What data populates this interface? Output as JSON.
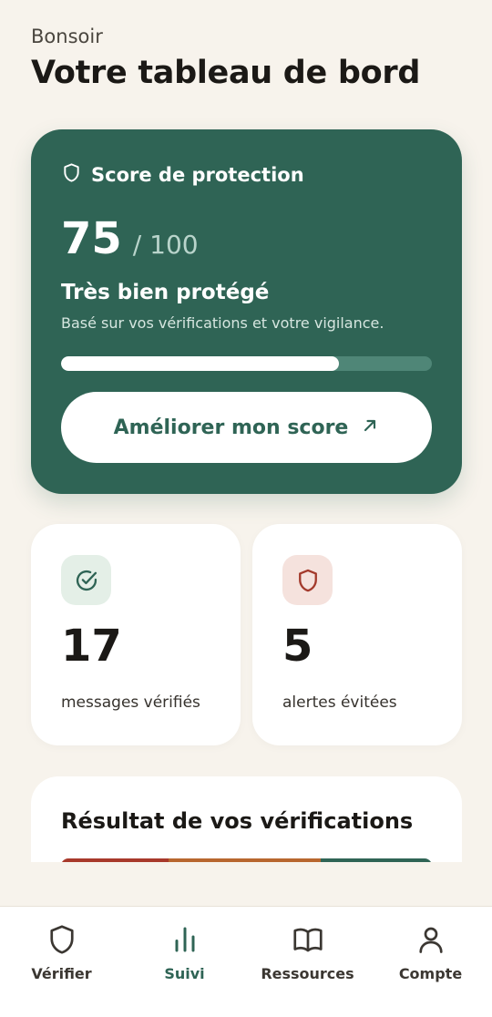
{
  "header": {
    "greeting": "Bonsoir",
    "title": "Votre tableau de bord"
  },
  "score_card": {
    "icon": "shield-icon",
    "label": "Score de protection",
    "value": "75",
    "max": "/ 100",
    "progress_percent": 75,
    "status": "Très bien protégé",
    "description": "Basé sur vos vérifications et votre vigilance.",
    "button_label": "Améliorer mon score",
    "button_icon": "arrow-up-right-icon",
    "colors": {
      "card": "#2f6455",
      "track": "#4f8677",
      "fill": "#ffffff"
    }
  },
  "stats": [
    {
      "value": "17",
      "label": "messages vérifiés",
      "icon": "check-circle-icon",
      "color": "#2f6455"
    },
    {
      "value": "5",
      "label": "alertes évitées",
      "icon": "shield-alert-icon",
      "color": "#a33a2c"
    }
  ],
  "results": {
    "title": "Résultat de vos vérifications",
    "segments": [
      {
        "color": "#a8392b",
        "fraction": 0.29
      },
      {
        "color": "#b8662e",
        "fraction": 0.41
      },
      {
        "color": "#2f6455",
        "fraction": 0.3
      }
    ]
  },
  "nav": {
    "items": [
      {
        "label": "Vérifier",
        "icon": "shield-icon",
        "active": false
      },
      {
        "label": "Suivi",
        "icon": "bar-chart-icon",
        "active": true
      },
      {
        "label": "Ressources",
        "icon": "book-icon",
        "active": false
      },
      {
        "label": "Compte",
        "icon": "user-icon",
        "active": false
      }
    ]
  }
}
